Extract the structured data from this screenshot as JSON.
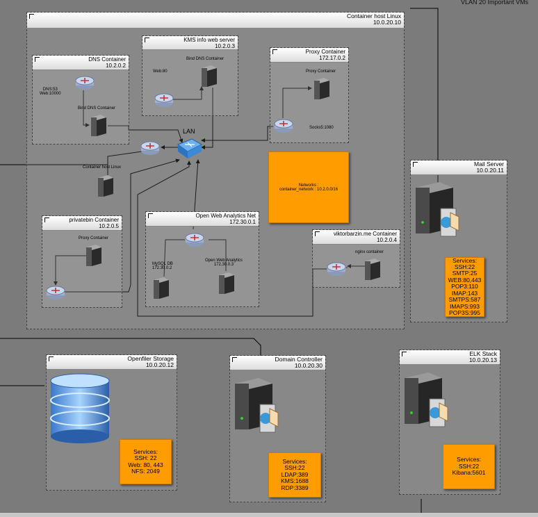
{
  "header": {
    "vlan_title": "VLAN 20 Important VMs"
  },
  "groups": {
    "container_host": {
      "title": "Container host Linux",
      "ip": "10.0.20.10"
    },
    "dns": {
      "title": "DNS Container",
      "ip": "10.2.0.2"
    },
    "kms": {
      "title": "KMS info web server",
      "ip": "10.2.0.3"
    },
    "proxy": {
      "title": "Proxy Container",
      "ip": "172.17.0.2"
    },
    "privatebin": {
      "title": "privatebin Container",
      "ip": "10.2.0.5"
    },
    "owa": {
      "title": "Open Web Analytics Net",
      "ip": "172.30.0.1"
    },
    "viktor": {
      "title": "viktorbarzin.me Container",
      "ip": "10.2.0.4"
    },
    "mail": {
      "title": "Mail Server",
      "ip": "10.0.20.11"
    },
    "openfiler": {
      "title": "Openfiler Storage",
      "ip": "10.0.20.12"
    },
    "dc": {
      "title": "Domain Controller",
      "ip": "10.0.20.30"
    },
    "elk": {
      "title": "ELK Stack",
      "ip": "10.0.20.13"
    }
  },
  "labels": {
    "dns_ports": "DNS:53\nWeb:10000",
    "bind_dns_1": "Bind DNS Container",
    "kms_web": "Web:80",
    "bind_dns_2": "Bind DNS Container",
    "proxy_inner": "Proxy Container",
    "socks": "Socks5:1080",
    "lan": "LAN",
    "container_host_linux": "Container host Linux",
    "privatebin_proxy": "Proxy Container",
    "mysql": "MySQL DB\n172.30.0.2",
    "owa_server": "Open Web Analytics\n172.30.0.3",
    "nginx": "nginx container"
  },
  "network_note": "Networks :\ncontainer_network : 10.2.0.0/16",
  "services": {
    "mail": "Services:\nSSH:22\nSMTP:25\nWEB:80,443\nPOP3:110\nIMAP:143\nSMTPS:587\nIMAPS:993\nPOP3S:995",
    "openfiler": "Services:\nSSH: 22\nWeb: 80, 443\nNFS: 2049",
    "dc": "Services:\nSSH:22\nLDAP:389\nKMS:1688\nRDP:3389",
    "elk": "Services:\nSSH:22\nKibana:5601"
  },
  "icons": [
    "router-icon",
    "switch-icon",
    "server-icon",
    "big-server-icon",
    "database-icon"
  ],
  "colors": {
    "background": "#7b7b7b",
    "service_box": "#ff9c00",
    "router": "#b8c8e8",
    "switch": "#3a8ad8"
  }
}
